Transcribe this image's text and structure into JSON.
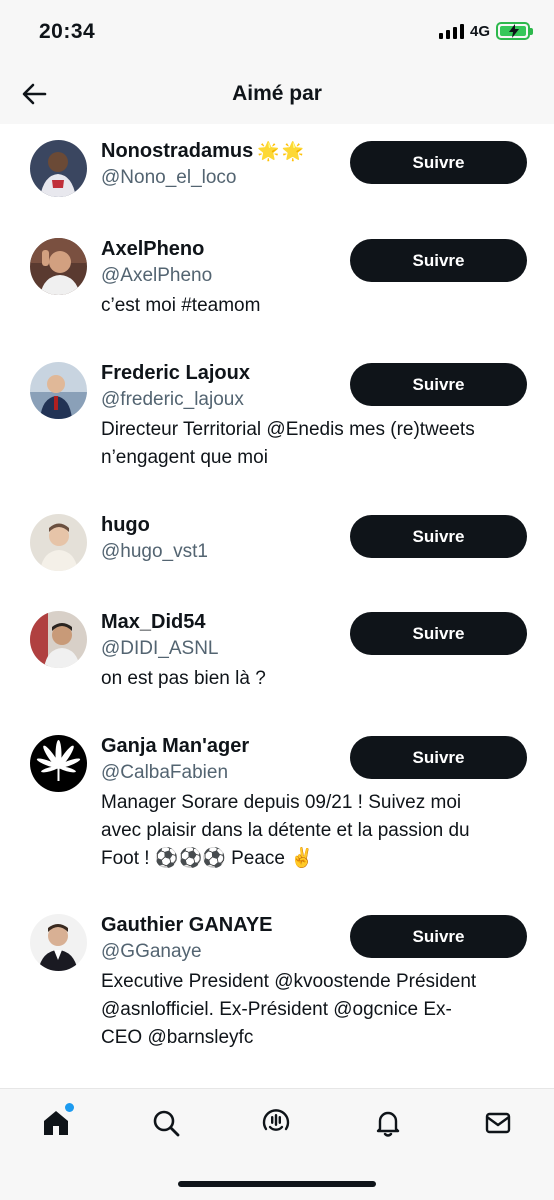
{
  "status_bar": {
    "time": "20:34",
    "network": "4G",
    "battery_icon": "battery-charging-icon",
    "signal_icon": "signal-bars-icon"
  },
  "header": {
    "title": "Aimé par",
    "back_icon": "arrow-left-icon"
  },
  "users": [
    {
      "name": "Nonostradamus",
      "emoji": "🌟🌟",
      "handle": "@Nono_el_loco",
      "bio": [],
      "button": "Suivre"
    },
    {
      "name": "AxelPheno",
      "emoji": "",
      "handle": "@AxelPheno",
      "bio": [
        "c’est moi #teamom"
      ],
      "button": "Suivre"
    },
    {
      "name": "Frederic Lajoux",
      "emoji": "",
      "handle": "@frederic_lajoux",
      "bio": [
        "Directeur Territorial @Enedis mes (re)tweets",
        "n’engagent que moi"
      ],
      "button": "Suivre"
    },
    {
      "name": "hugo",
      "emoji": "",
      "handle": "@hugo_vst1",
      "bio": [],
      "button": "Suivre"
    },
    {
      "name": "Max_Did54",
      "emoji": "",
      "handle": "@DIDI_ASNL",
      "bio": [
        "on est pas bien là ?"
      ],
      "button": "Suivre"
    },
    {
      "name": "Ganja Man'ager",
      "emoji": "",
      "handle": "@CalbaFabien",
      "bio": [
        "Manager Sorare depuis 09/21 ! Suivez moi",
        "avec plaisir dans la détente et la passion du",
        "Foot ! ⚽️⚽️⚽️ Peace ✌️"
      ],
      "button": "Suivre"
    },
    {
      "name": "Gauthier GANAYE",
      "emoji": "",
      "handle": "@GGanaye",
      "bio": [
        "Executive President @kvoostende Président",
        "@asnlofficiel. Ex-Président @ogcnice Ex-",
        "CEO @barnsleyfc"
      ],
      "button": "Suivre"
    }
  ],
  "tab_bar": {
    "tabs": [
      "home-icon",
      "search-icon",
      "spaces-icon",
      "bell-icon",
      "mail-icon"
    ]
  },
  "colors": {
    "text": "#0f1419",
    "secondary": "#536471",
    "accent": "#1d9bf0",
    "button_bg": "#0f1419"
  }
}
